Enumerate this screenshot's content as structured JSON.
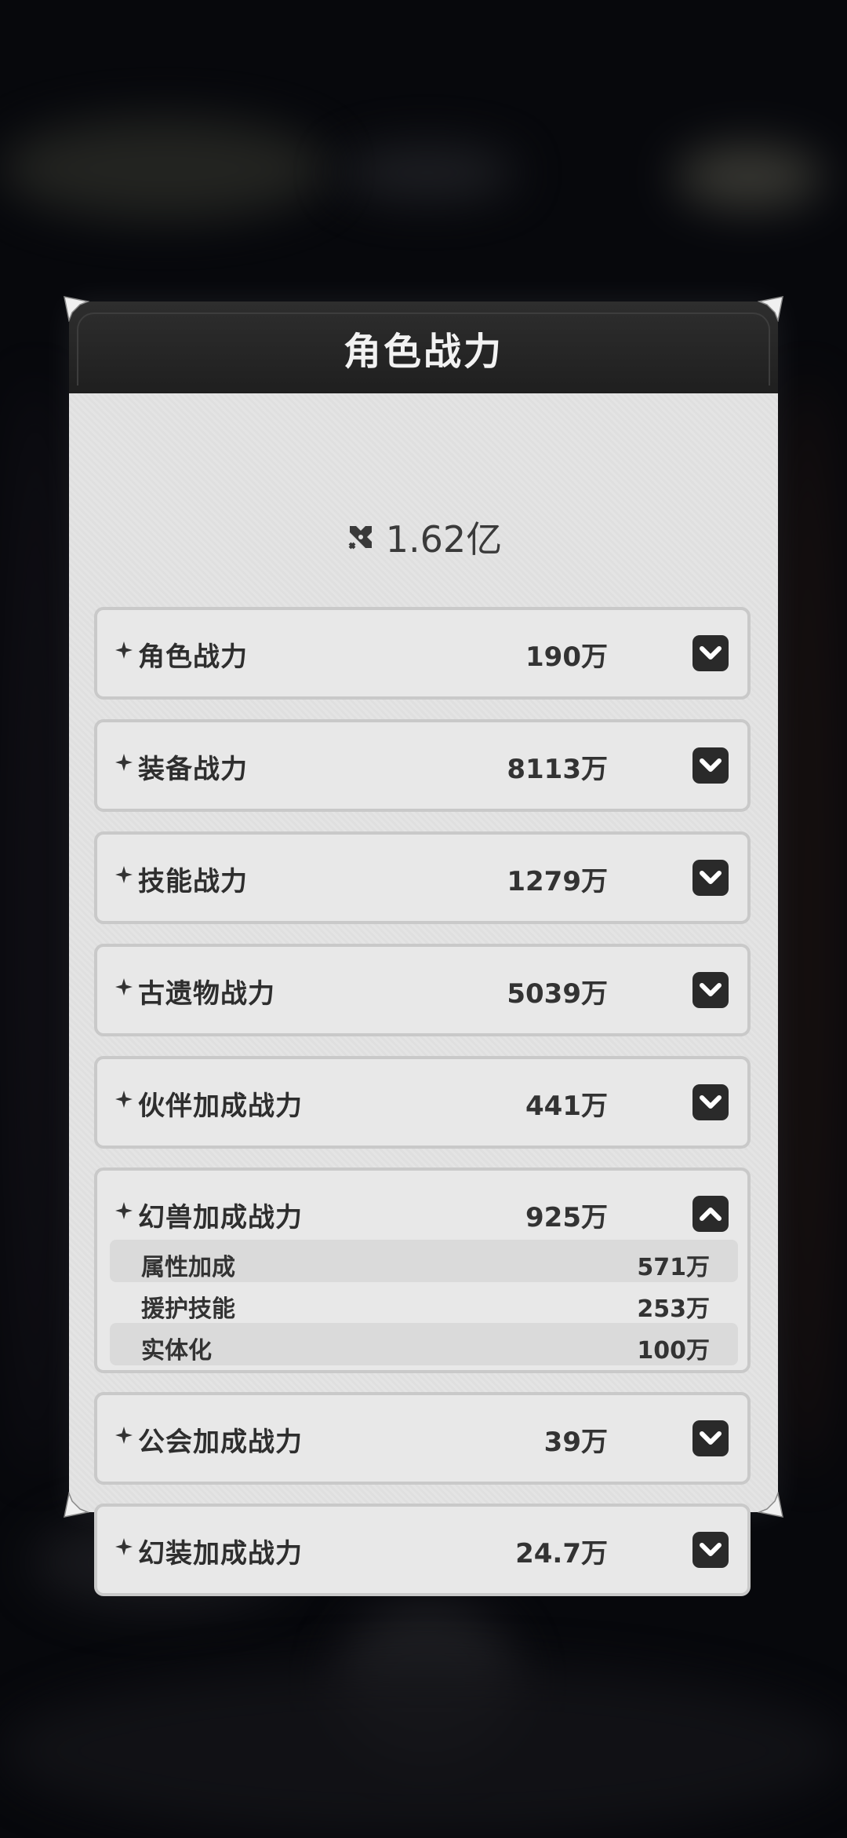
{
  "panel": {
    "title": "角色战力",
    "total_power": "1.62亿"
  },
  "stats": [
    {
      "label": "角色战力",
      "value": "190万",
      "expanded": false
    },
    {
      "label": "装备战力",
      "value": "8113万",
      "expanded": false
    },
    {
      "label": "技能战力",
      "value": "1279万",
      "expanded": false
    },
    {
      "label": "古遗物战力",
      "value": "5039万",
      "expanded": false
    },
    {
      "label": "伙伴加成战力",
      "value": "441万",
      "expanded": false
    },
    {
      "label": "幻兽加成战力",
      "value": "925万",
      "expanded": true,
      "details": [
        {
          "label": "属性加成",
          "value": "571万"
        },
        {
          "label": "援护技能",
          "value": "253万"
        },
        {
          "label": "实体化",
          "value": "100万"
        }
      ]
    },
    {
      "label": "公会加成战力",
      "value": "39万",
      "expanded": false
    },
    {
      "label": "幻装加成战力",
      "value": "24.7万",
      "expanded": false
    }
  ],
  "icons": {
    "total": "crossed-swords-icon",
    "bullet": "sparkle-icon",
    "collapsed": "chevron-down-icon",
    "expanded": "chevron-up-icon"
  },
  "colors": {
    "header": "#1f1f1f",
    "panel": "#e4e4e4",
    "toggle": "#2a2a2a"
  }
}
